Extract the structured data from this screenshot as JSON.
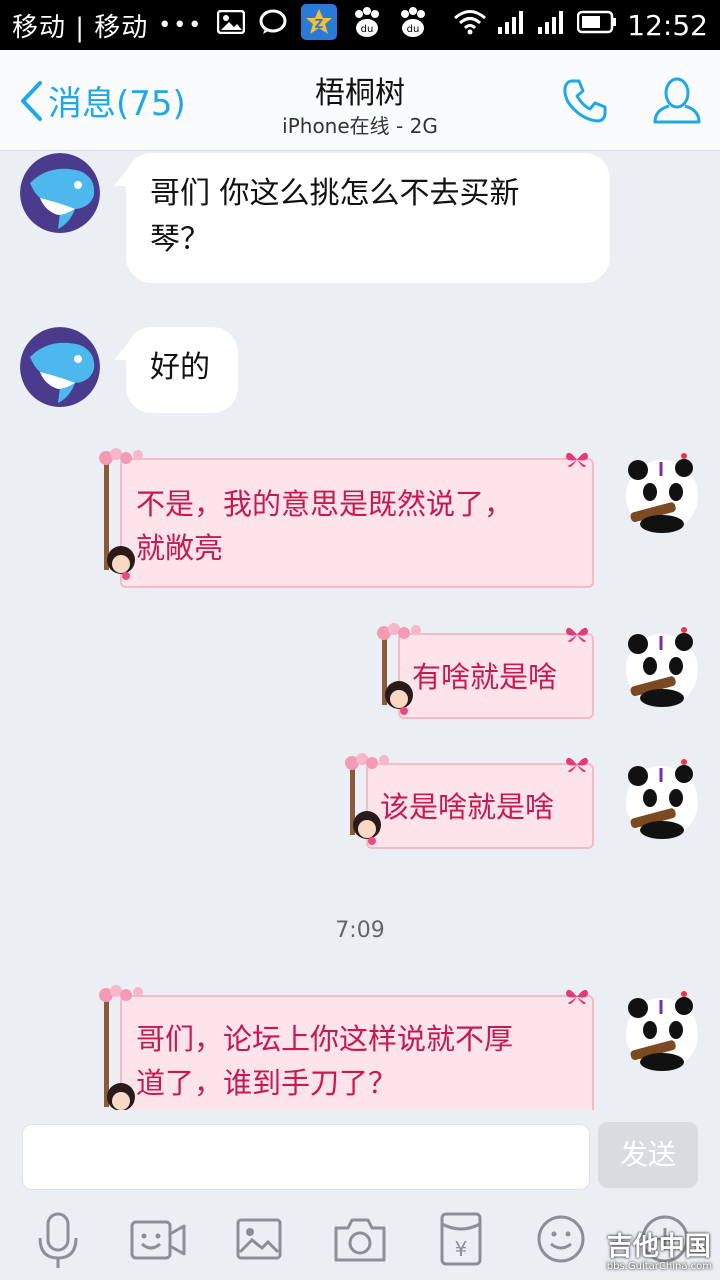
{
  "status_bar": {
    "carrier": "移动 | 移动",
    "dots": "•••",
    "time": "12:52"
  },
  "header": {
    "back_label": "消息(75)",
    "title": "梧桐树",
    "subtitle": "iPhone在线 - 2G"
  },
  "messages": [
    {
      "side": "in",
      "text_line1": "哥们 你这么挑怎么不去买新",
      "text_line2": "琴？"
    },
    {
      "side": "in",
      "text": "好的"
    },
    {
      "side": "out",
      "text_line1": "不是，我的意思是既然说了，",
      "text_line2": "就敞亮"
    },
    {
      "side": "out",
      "text": "有啥就是啥"
    },
    {
      "side": "out",
      "text": "该是啥就是啥"
    },
    {
      "side": "out",
      "text_line1": "哥们，论坛上你这样说就不厚",
      "text_line2": "道了，谁到手刀了？"
    }
  ],
  "timestamp": "7:09",
  "input": {
    "placeholder": "",
    "send_label": "发送"
  },
  "toolbar_icons": [
    "mic-icon",
    "video-icon",
    "image-icon",
    "camera-icon",
    "red-packet-icon",
    "emoji-icon",
    "plus-icon"
  ],
  "watermark": {
    "main": "吉他中国",
    "sub": "bbs.GuitarChina.com"
  },
  "colors": {
    "accent": "#1fa8e8",
    "out_text": "#c8194f",
    "out_bg": "#fde4ea",
    "background": "#ebeef3"
  }
}
